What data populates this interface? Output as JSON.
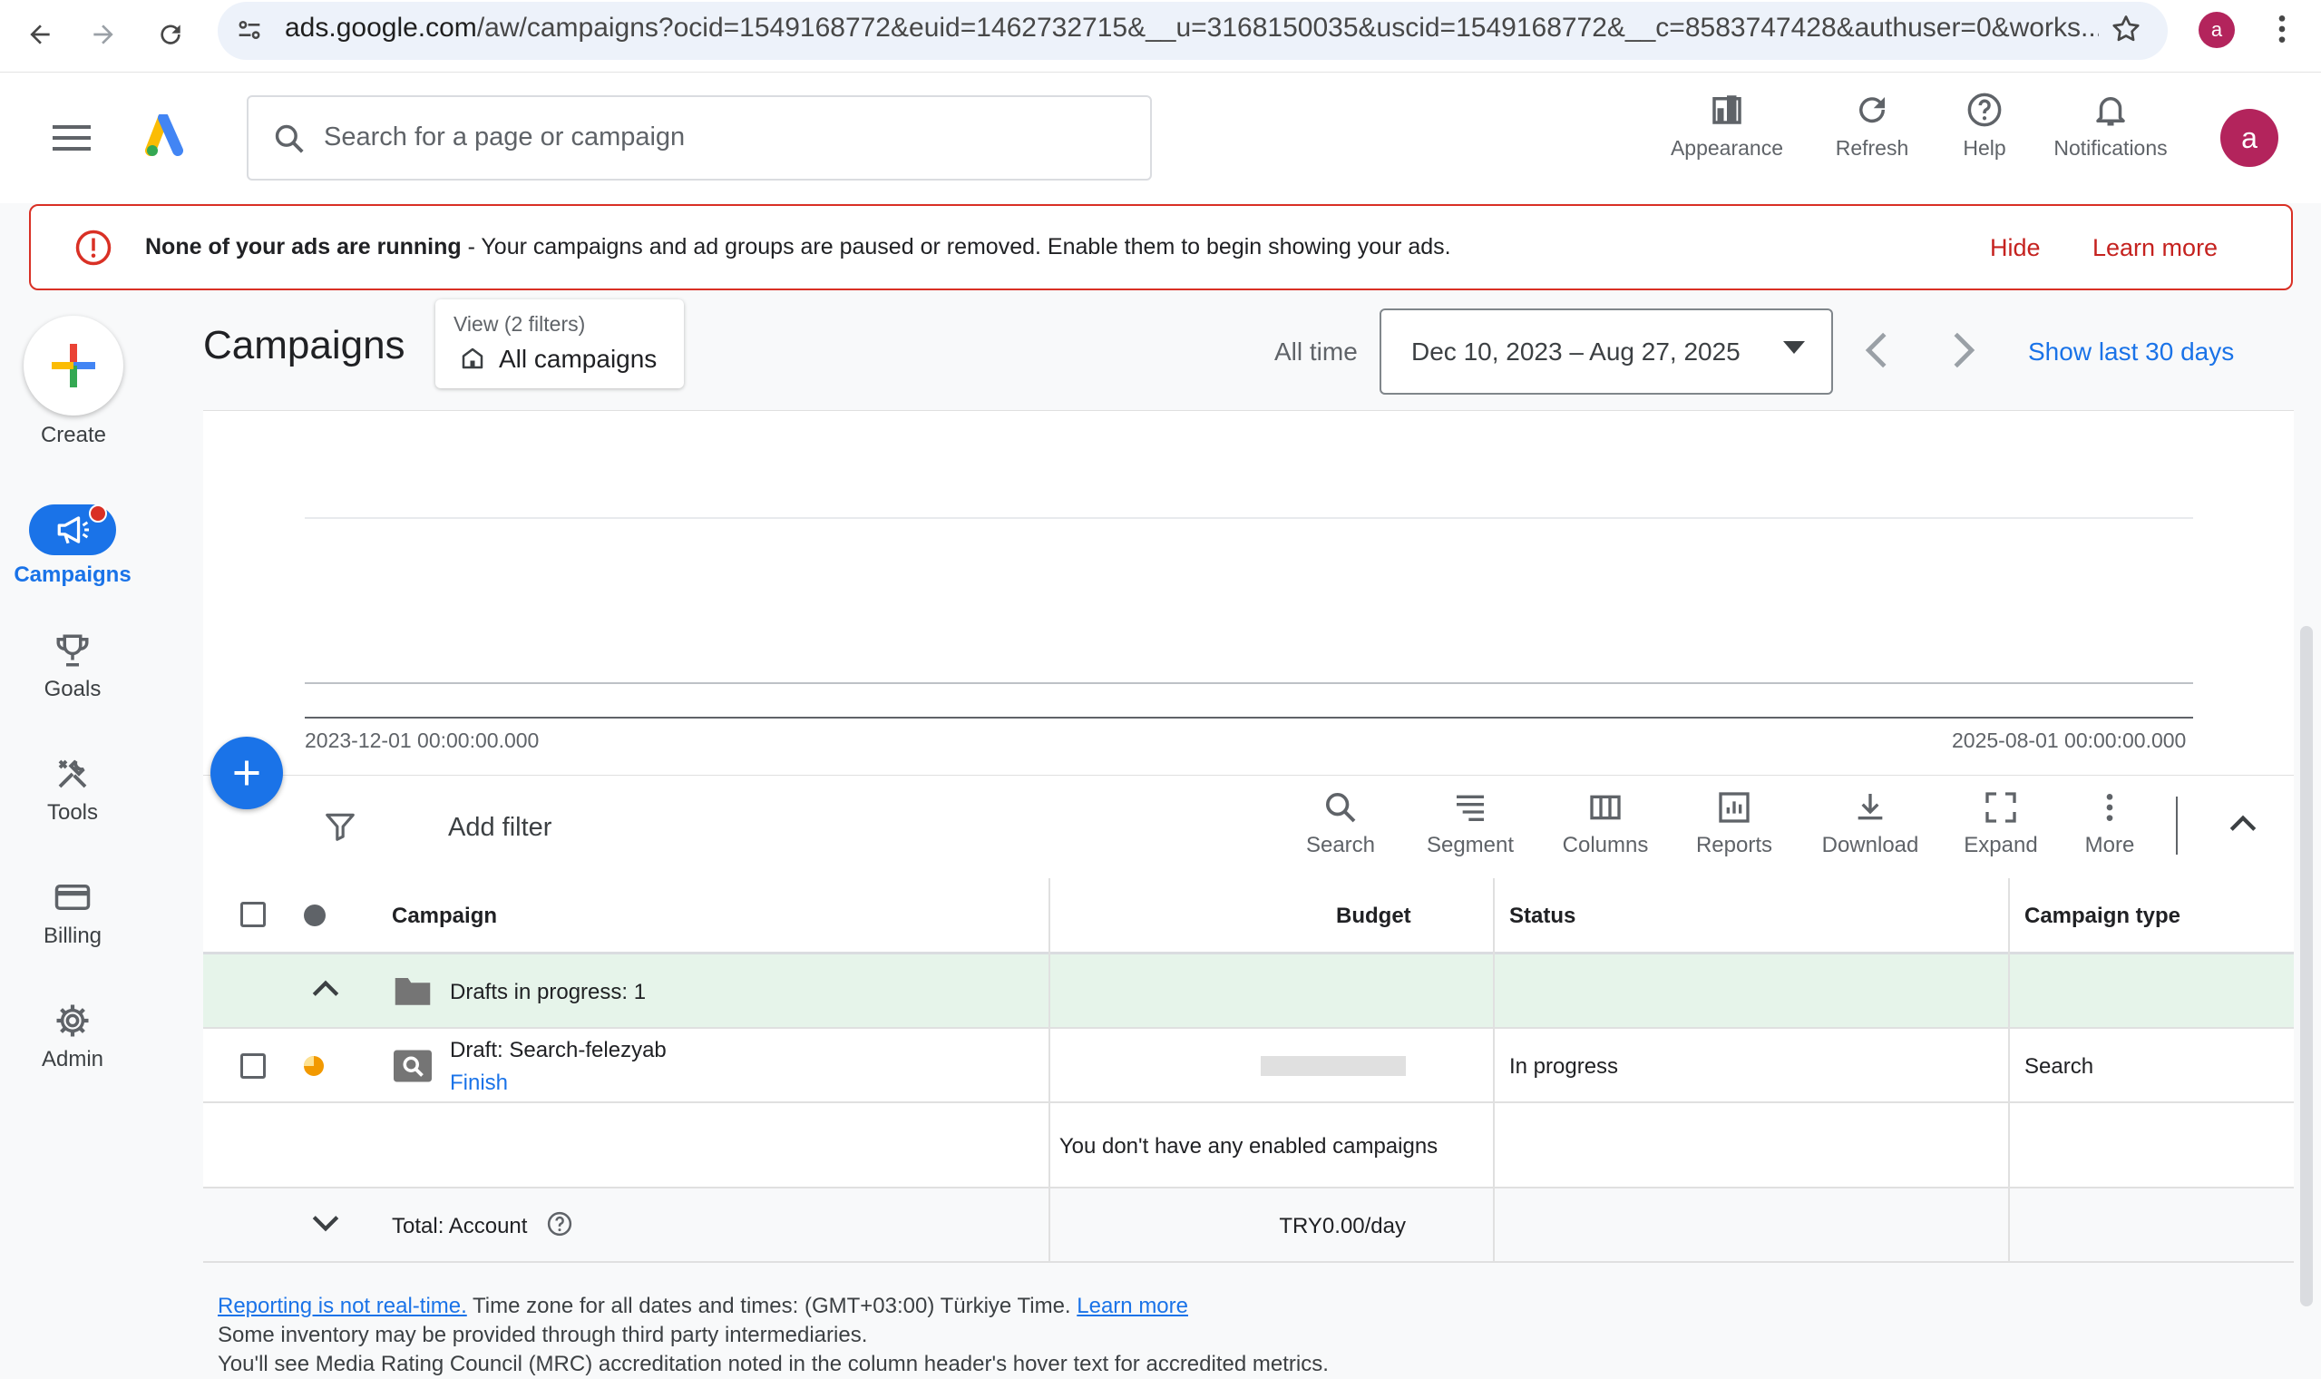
{
  "browser": {
    "url_host": "ads.google.com",
    "url_rest": "/aw/campaigns?ocid=1549168772&euid=1462732715&__u=3168150035&uscid=1549168772&__c=8583747428&authuser=0&works...",
    "profile_initial": "a"
  },
  "header": {
    "search_placeholder": "Search for a page or campaign",
    "buttons": [
      {
        "label": "Appearance",
        "icon": "appearance-icon"
      },
      {
        "label": "Refresh",
        "icon": "refresh-icon"
      },
      {
        "label": "Help",
        "icon": "help-icon"
      },
      {
        "label": "Notifications",
        "icon": "bell-icon"
      }
    ],
    "avatar_initial": "a"
  },
  "alert": {
    "bold": "None of your ads are running",
    "text": " - Your campaigns and ad groups are paused or removed. Enable them to begin showing your ads.",
    "hide_label": "Hide",
    "learn_label": "Learn more"
  },
  "nav": {
    "create_label": "Create",
    "items": [
      {
        "label": "Campaigns",
        "icon": "megaphone-icon",
        "active": true
      },
      {
        "label": "Goals",
        "icon": "trophy-icon"
      },
      {
        "label": "Tools",
        "icon": "tools-icon"
      },
      {
        "label": "Billing",
        "icon": "credit-card-icon"
      },
      {
        "label": "Admin",
        "icon": "gear-icon"
      }
    ]
  },
  "page": {
    "title": "Campaigns",
    "view_filters": "View (2 filters)",
    "view_name": "All campaigns",
    "all_time": "All time",
    "date_range": "Dec 10, 2023 – Aug 27, 2025",
    "show_last": "Show last 30 days"
  },
  "chart": {
    "x_start": "2023-12-01 00:00:00.000",
    "x_end": "2025-08-01 00:00:00.000"
  },
  "toolbar": {
    "add_filter": "Add filter",
    "tools": [
      {
        "label": "Search",
        "icon": "search-icon"
      },
      {
        "label": "Segment",
        "icon": "segment-icon"
      },
      {
        "label": "Columns",
        "icon": "columns-icon"
      },
      {
        "label": "Reports",
        "icon": "reports-icon"
      },
      {
        "label": "Download",
        "icon": "download-icon"
      },
      {
        "label": "Expand",
        "icon": "expand-icon"
      },
      {
        "label": "More",
        "icon": "more-vert-icon"
      }
    ]
  },
  "table": {
    "headers": {
      "campaign": "Campaign",
      "budget": "Budget",
      "status": "Status",
      "type": "Campaign type"
    },
    "drafts_group": "Drafts in progress: 1",
    "row": {
      "name": "Draft: Search-felezyab",
      "action": "Finish",
      "status": "In progress",
      "type": "Search"
    },
    "empty_message": "You don't have any enabled campaigns",
    "total_label": "Total: Account",
    "total_budget": "TRY0.00/day"
  },
  "footer": {
    "link1": "Reporting is not real-time.",
    "tz_text": " Time zone for all dates and times: (GMT+03:00) Türkiye Time. ",
    "link2": "Learn more",
    "line2": "Some inventory may be provided through third party intermediaries.",
    "line3": "You'll see Media Rating Council (MRC) accreditation noted in the column header's hover text for accredited metrics."
  },
  "colors": {
    "accent": "#1a73e8",
    "alert": "#d93025",
    "draft_row": "#e6f4ea",
    "avatar": "#b3245c"
  }
}
